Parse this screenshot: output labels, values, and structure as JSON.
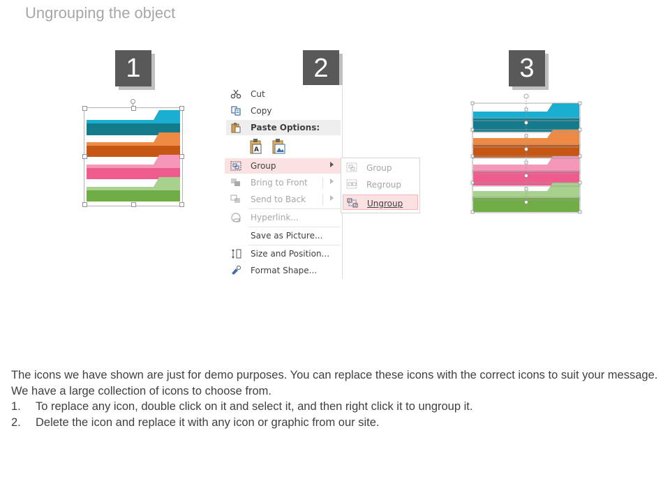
{
  "slide": {
    "title": "Ungrouping the object"
  },
  "steps": [
    "1",
    "2",
    "3"
  ],
  "colors": {
    "teal": "#1aaed0",
    "teal_dark": "#147b8d",
    "orange": "#ef8a45",
    "orange_dark": "#c55614",
    "pink": "#f597b9",
    "pink_dark": "#ef5b8c",
    "green": "#a9d18e",
    "green_dark": "#70ad47",
    "badge": "#595959"
  },
  "context_menu": {
    "items": [
      {
        "label": "Cut",
        "icon": "scissors-icon",
        "state": "enabled"
      },
      {
        "label": "Copy",
        "icon": "copy-icon",
        "state": "enabled"
      },
      {
        "label": "Paste Options:",
        "icon": "paste-icon",
        "state": "header"
      },
      {
        "label": "Group",
        "icon": "group-icon",
        "state": "highlighted",
        "submenu": true
      },
      {
        "label": "Bring to Front",
        "icon": "bring-to-front-icon",
        "state": "disabled",
        "submenu": true
      },
      {
        "label": "Send to Back",
        "icon": "send-to-back-icon",
        "state": "disabled",
        "submenu": true
      },
      {
        "label": "Hyperlink...",
        "icon": "hyperlink-icon",
        "state": "disabled"
      },
      {
        "label": "Save as Picture...",
        "state": "enabled"
      },
      {
        "label": "Size and Position...",
        "icon": "size-position-icon",
        "state": "enabled"
      },
      {
        "label": "Format Shape...",
        "icon": "format-shape-icon",
        "state": "enabled"
      }
    ],
    "paste_icons": [
      "paste-keep-text-icon",
      "paste-picture-icon"
    ]
  },
  "submenu": {
    "items": [
      {
        "label": "Group",
        "icon": "group-icon",
        "state": "disabled"
      },
      {
        "label": "Regroup",
        "icon": "regroup-icon",
        "state": "disabled"
      },
      {
        "label": "Ungroup",
        "icon": "ungroup-icon",
        "state": "highlighted"
      }
    ]
  },
  "body": {
    "intro": "The icons we have shown are just for demo purposes. You can replace these icons with the correct icons to suit your message. We have a large collection of icons to choose from.",
    "steps": [
      {
        "num": "1.",
        "text": "To replace any icon, double click on it and select it, and then right click it to ungroup it."
      },
      {
        "num": "2.",
        "text": "Delete the icon and replace it with any icon or graphic from our site."
      }
    ]
  }
}
